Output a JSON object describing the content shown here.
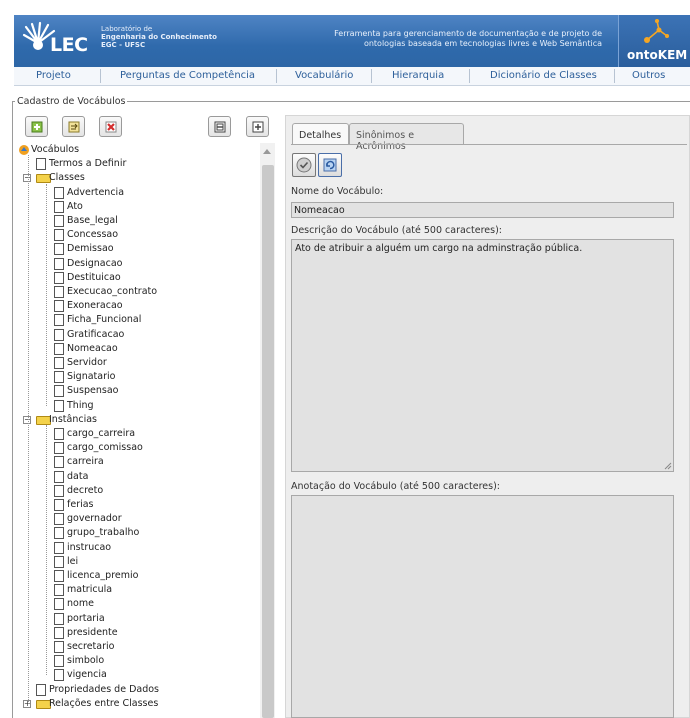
{
  "header": {
    "lab_line1": "Laboratório de",
    "lab_line2": "Engenharia do Conhecimento",
    "lab_line3": "EGC - UFSC",
    "logo_text": "LEC",
    "tagline": "Ferramenta para gerenciamento de documentação e de projeto de ontologias baseada em tecnologias livres e Web Semântica",
    "app_name": "ontoKEM"
  },
  "menu": [
    "Projeto",
    "Perguntas de Competência",
    "Vocabulário",
    "Hierarquia",
    "Dicionário de Classes",
    "Outros"
  ],
  "fieldset_legend": "Cadastro de Vocábulos",
  "toolbar": {
    "icons": [
      "add-icon",
      "edit-icon",
      "delete-icon",
      "collapse-all-icon",
      "expand-all-icon"
    ]
  },
  "tree": {
    "root": "Vocábulos",
    "termos": "Termos a Definir",
    "classes_label": "Classes",
    "classes": [
      "Advertencia",
      "Ato",
      "Base_legal",
      "Concessao",
      "Demissao",
      "Designacao",
      "Destituicao",
      "Execucao_contrato",
      "Exoneracao",
      "Ficha_Funcional",
      "Gratificacao",
      "Nomeacao",
      "Servidor",
      "Signatario",
      "Suspensao",
      "Thing"
    ],
    "instancias_label": "Instâncias",
    "instancias": [
      "cargo_carreira",
      "cargo_comissao",
      "carreira",
      "data",
      "decreto",
      "ferias",
      "governador",
      "grupo_trabalho",
      "instrucao",
      "lei",
      "licenca_premio",
      "matricula",
      "nome",
      "portaria",
      "presidente",
      "secretario",
      "simbolo",
      "vigencia"
    ],
    "propriedades": "Propriedades de Dados",
    "relacoes": "Relações entre Classes"
  },
  "tabs": [
    "Detalhes",
    "Sinônimos e Acrônimos"
  ],
  "form": {
    "nome_label": "Nome do Vocábulo:",
    "nome_value": "Nomeacao",
    "descricao_label": "Descrição do Vocábulo (até 500 caracteres):",
    "descricao_value": "Ato de atribuir a alguém um cargo na adminstração pública.",
    "anotacao_label": "Anotação do Vocábulo (até 500 caracteres):",
    "anotacao_value": ""
  }
}
